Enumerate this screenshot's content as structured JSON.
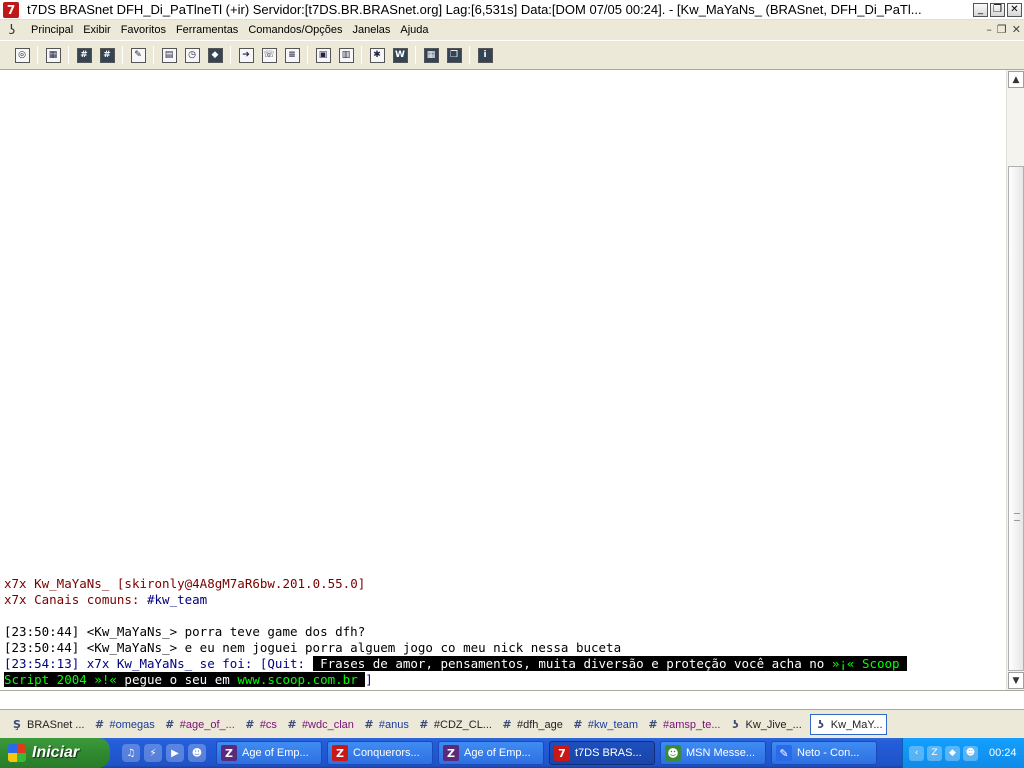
{
  "window": {
    "app_icon": "7",
    "title": "t7DS BRASnet DFH_Di_PaTlneTl (+ir) Servidor:[t7DS.BR.BRASnet.org] Lag:[6,531s] Data:[DOM 07/05 00:24]. - [Kw_MaYaNs_ (BRASnet, DFH_Di_PaTl...",
    "buttons": {
      "minimize": "_",
      "restore": "❐",
      "close": "✕"
    }
  },
  "menubar": {
    "items": [
      "Principal",
      "Exibir",
      "Favoritos",
      "Ferramentas",
      "Comandos/Opções",
      "Janelas",
      "Ajuda"
    ],
    "mdi": {
      "minimize": "–",
      "restore": "❐",
      "close": "✕"
    }
  },
  "toolbar": {
    "buttons": [
      "connect-icon",
      "options-icon",
      "channels-icon",
      "channel-list-icon",
      "address-book-icon",
      "notify-icon",
      "timer-icon",
      "colors-icon",
      "send-icon",
      "dcc-chat-icon",
      "dcc-send-icon",
      "log-icon",
      "notes-icon",
      "users-icon",
      "urls-icon",
      "tile-icon",
      "cascade-icon",
      "info-icon"
    ]
  },
  "chat": {
    "lines": [
      {
        "parts": [
          {
            "t": "x7x Kw_MaYaNs_ [",
            "c": "maroon"
          },
          {
            "t": "skironly@4A8gM7aR6bw.201.0.55.0",
            "c": "maroon"
          },
          {
            "t": "]",
            "c": "maroon"
          }
        ]
      },
      {
        "parts": [
          {
            "t": "x7x Canais comuns: ",
            "c": "maroon"
          },
          {
            "t": "#kw_team",
            "c": "navy"
          }
        ]
      },
      {
        "parts": [
          {
            "t": " ",
            "c": ""
          }
        ]
      },
      {
        "parts": [
          {
            "t": "[23:50:44] <Kw_MaYaNs_> porra teve game dos dfh?",
            "c": ""
          }
        ]
      },
      {
        "parts": [
          {
            "t": "[23:50:44] <Kw_MaYaNs_> e eu nem joguei porra alguem jogo co meu nick nessa buceta",
            "c": ""
          }
        ]
      },
      {
        "parts": [
          {
            "t": "[23:54:13] x7x Kw_MaYaNs_ se foi: [Quit: ",
            "c": "navy"
          },
          {
            "t": " Frases de amor, pensamentos, muita diversão e proteção você acha no ",
            "c": "hl"
          },
          {
            "t": "»¡« Scoop ",
            "c": "hl-green"
          }
        ]
      },
      {
        "parts": [
          {
            "t": "Script 2004 »!« ",
            "c": "hl-green"
          },
          {
            "t": "pegue o seu em ",
            "c": "hl"
          },
          {
            "t": "www.scoop.com.br ",
            "c": "hl-green"
          },
          {
            "t": "]",
            "c": "navy"
          }
        ]
      }
    ]
  },
  "input": {
    "value": ""
  },
  "switchbar": {
    "items": [
      {
        "icon": "server-icon",
        "glyph": "Ş",
        "label": "BRASnet ...",
        "style": "dark"
      },
      {
        "icon": "channel-icon",
        "glyph": "#",
        "label": "#omegas",
        "style": "blue"
      },
      {
        "icon": "channel-icon",
        "glyph": "#",
        "label": "#age_of_...",
        "style": "purple"
      },
      {
        "icon": "channel-icon",
        "glyph": "#",
        "label": "#cs",
        "style": "purple"
      },
      {
        "icon": "channel-icon",
        "glyph": "#",
        "label": "#wdc_clan",
        "style": "purple"
      },
      {
        "icon": "channel-icon",
        "glyph": "#",
        "label": "#anus",
        "style": "blue"
      },
      {
        "icon": "channel-icon",
        "glyph": "#",
        "label": "#CDZ_CL...",
        "style": "dark"
      },
      {
        "icon": "channel-icon",
        "glyph": "#",
        "label": "#dfh_age",
        "style": "dark"
      },
      {
        "icon": "channel-icon",
        "glyph": "#",
        "label": "#kw_team",
        "style": "blue"
      },
      {
        "icon": "channel-icon",
        "glyph": "#",
        "label": "#amsp_te...",
        "style": "purple"
      },
      {
        "icon": "query-icon",
        "glyph": "ʖ",
        "label": "Kw_Jive_...",
        "style": "dark"
      },
      {
        "icon": "query-icon",
        "glyph": "ʖ",
        "label": "Kw_MaY...",
        "style": "dark",
        "active": true
      }
    ]
  },
  "taskbar": {
    "start_label": "Iniciar",
    "quick_launch": [
      "♫",
      "⚡",
      "▶",
      "☻"
    ],
    "tasks": [
      {
        "glyph": "Z",
        "color": "#5b2a7a",
        "label": "Age of Emp..."
      },
      {
        "glyph": "Z",
        "color": "#c81818",
        "label": "Conquerors..."
      },
      {
        "glyph": "Z",
        "color": "#5b2a7a",
        "label": "Age of Emp..."
      },
      {
        "glyph": "7",
        "color": "#c81818",
        "label": "t7DS BRAS...",
        "active": true
      },
      {
        "glyph": "☻",
        "color": "#3a8a3a",
        "label": "MSN Messe..."
      },
      {
        "glyph": "✎",
        "color": "#2a6ae8",
        "label": "Neto - Con..."
      }
    ],
    "tray_icons": [
      "‹",
      "Z",
      "◆",
      "☻"
    ],
    "clock": "00:24"
  }
}
